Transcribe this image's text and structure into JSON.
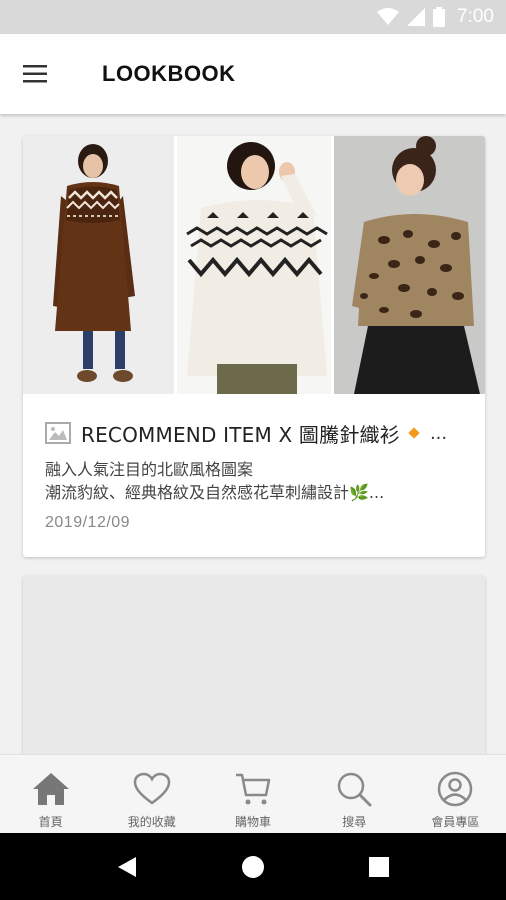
{
  "status_bar": {
    "time": "7:00",
    "icons": [
      "wifi-icon",
      "signal-icon",
      "battery-icon"
    ]
  },
  "app_bar": {
    "title": "LOOKBOOK",
    "menu_icon": "menu-icon"
  },
  "cards": [
    {
      "title": "RECOMMEND ITEM X 圖騰針織衫",
      "title_suffix": "...",
      "description": [
        "融入人氣注目的北歐風格圖案",
        "潮流豹紋、經典格紋及自然感花草刺繡設計🌿..."
      ],
      "date": "2019/12/09",
      "images": [
        "model-brown-knit-dress",
        "model-white-fairisle-sweater",
        "model-leopard-sweater"
      ]
    }
  ],
  "bottom_nav": [
    {
      "label": "首頁",
      "icon": "home-icon",
      "active": true
    },
    {
      "label": "我的收藏",
      "icon": "heart-icon",
      "active": false
    },
    {
      "label": "購物車",
      "icon": "cart-icon",
      "active": false
    },
    {
      "label": "搜尋",
      "icon": "search-icon",
      "active": false
    },
    {
      "label": "會員專區",
      "icon": "account-icon",
      "active": false
    }
  ],
  "colors": {
    "accent": "#f39a1e",
    "icon_active": "#777777",
    "icon_inactive": "#8a8a8a",
    "status_bar": "#d9d9d9"
  }
}
